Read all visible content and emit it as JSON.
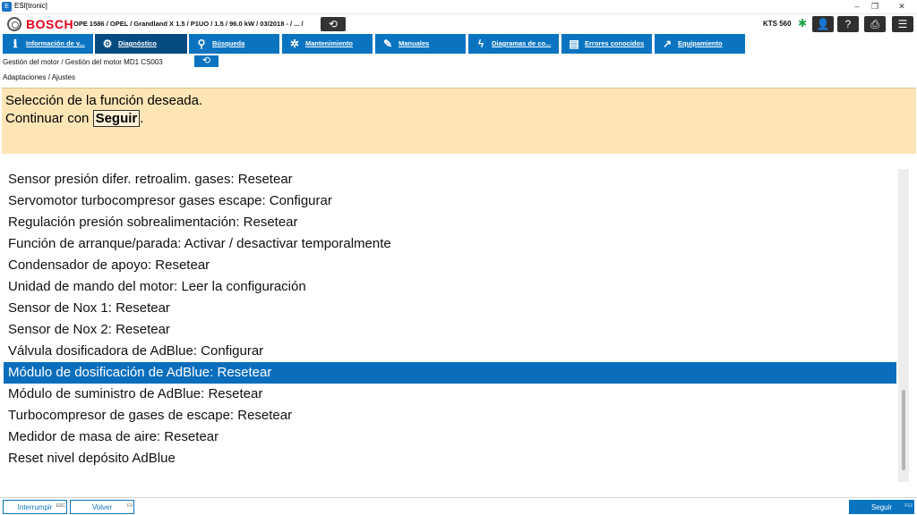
{
  "window": {
    "title": "ESI[tronic]",
    "minimize": "–",
    "restore": "❐",
    "close": "✕"
  },
  "header": {
    "brand": "BOSCH",
    "vehicle": "OPE 1586 / OPEL / Grandland X 1.5 / P1UO / 1.5 / 96.0 kW / 03/2018 - / ... /",
    "back_symbol": "⟲",
    "device": "KTS 560",
    "bluetooth_symbol": "✱",
    "tools": [
      {
        "icon": "user-icon",
        "symbol": "👤"
      },
      {
        "icon": "help-icon",
        "symbol": "?"
      },
      {
        "icon": "printer-icon",
        "symbol": "⎙"
      },
      {
        "icon": "menu-icon",
        "symbol": "☰"
      }
    ]
  },
  "nav": {
    "tabs": [
      {
        "label": "Información de v...",
        "icon": "info-icon",
        "symbol": "ℹ"
      },
      {
        "label": "Diagnóstico",
        "icon": "car-icon",
        "symbol": "⚙"
      },
      {
        "label": "Búsqueda",
        "icon": "search-icon",
        "symbol": "⚲"
      },
      {
        "label": "Mantenimiento",
        "icon": "gears-icon",
        "symbol": "✲"
      },
      {
        "label": "Manuales",
        "icon": "wrench-icon",
        "symbol": "✎"
      },
      {
        "label": "Diagramas de co...",
        "icon": "lightning-icon",
        "symbol": "ϟ"
      },
      {
        "label": "Errores conocidos",
        "icon": "book-icon",
        "symbol": "▤"
      },
      {
        "label": "Equipamiento",
        "icon": "external-link-icon",
        "symbol": "↗"
      }
    ]
  },
  "breadcrumb": {
    "path": "Gestión del motor / Gestión del motor MD1 CS003",
    "back_symbol": "⟲"
  },
  "subtitle": "Adaptaciones / Ajustes",
  "instructions": {
    "line1": "Selección de la función deseada.",
    "line2_prefix": "Continuar con",
    "line2_button": "Seguir",
    "line2_suffix": "."
  },
  "functions": {
    "items": [
      "Sensor presión difer. retroalim. gases: Resetear",
      "Servomotor turbocompresor gases escape: Configurar",
      "Regulación presión sobrealimentación: Resetear",
      "Función de arranque/parada: Activar / desactivar temporalmente",
      "Condensador de apoyo: Resetear",
      "Unidad de mando del motor: Leer la configuración",
      "Sensor de Nox 1: Resetear",
      "Sensor de Nox 2: Resetear",
      "Válvula dosificadora de AdBlue: Configurar",
      "Módulo de dosificación de AdBlue: Resetear",
      "Módulo de suministro de AdBlue: Resetear",
      "Turbocompresor de gases de escape: Resetear",
      "Medidor de masa de aire: Resetear",
      "Reset nivel depósito AdBlue"
    ],
    "selected_index": 9
  },
  "footer": {
    "cancel_label": "Interrumpir",
    "cancel_key": "ESC",
    "back_label": "Volver",
    "back_key": "F3",
    "next_label": "Seguir",
    "next_key": "F12"
  },
  "colors": {
    "accent": "#0a74c1",
    "active_tab": "#044b82",
    "instruction_bg": "#fde5b5",
    "brand_red": "#e2001a"
  }
}
